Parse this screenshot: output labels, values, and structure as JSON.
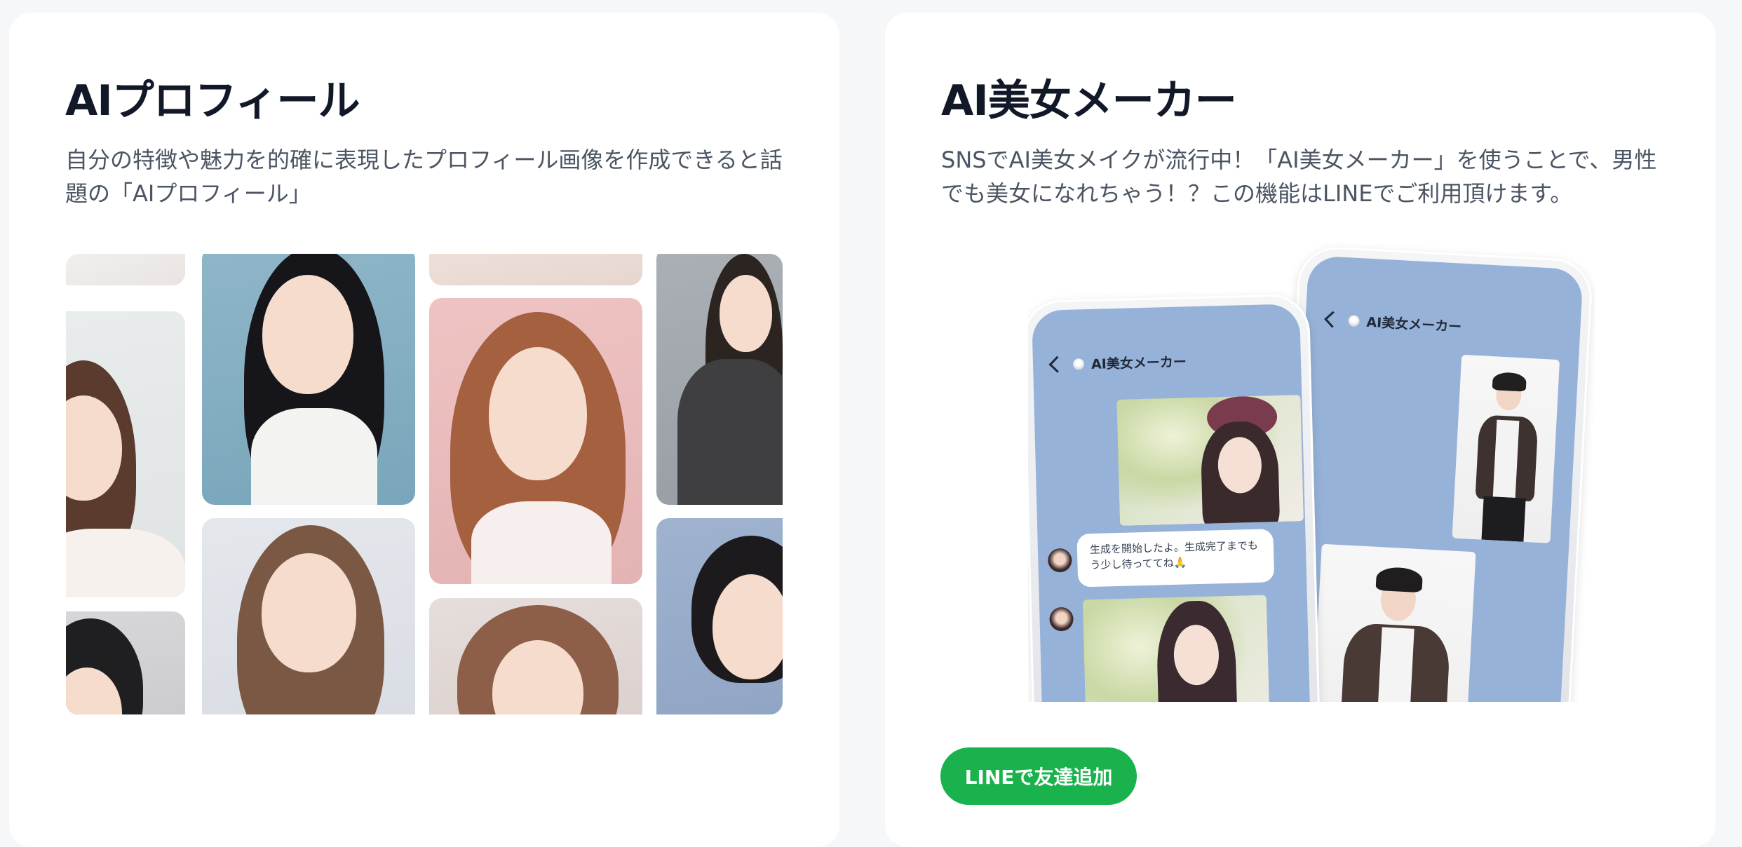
{
  "cards": [
    {
      "title": "AIプロフィール",
      "description": "自分の特徴や魅力を的確に表現したプロフィール画像を作成できると話題の「AIプロフィール」"
    },
    {
      "title": "AI美女メーカー",
      "description": "SNSでAI美女メイクが流行中！「AI美女メーカー」を使うことで、男性でも美女になれちゃう！？この機能はLINEでご利用頂けます。",
      "phone_front": {
        "chat_title": "AI美女メーカー",
        "bubble_text": "生成を開始したよ。生成完了までもう少し待っててね🙏"
      },
      "phone_back": {
        "chat_title": "AI美女メーカー"
      },
      "cta_label": "LINEで友達追加"
    }
  ],
  "colors": {
    "page_bg": "#f6f7f9",
    "card_bg": "#ffffff",
    "chat_bg": "#97b2d8",
    "cta_green": "#1ab24d",
    "title_text": "#111827",
    "body_text": "#4b5563"
  }
}
